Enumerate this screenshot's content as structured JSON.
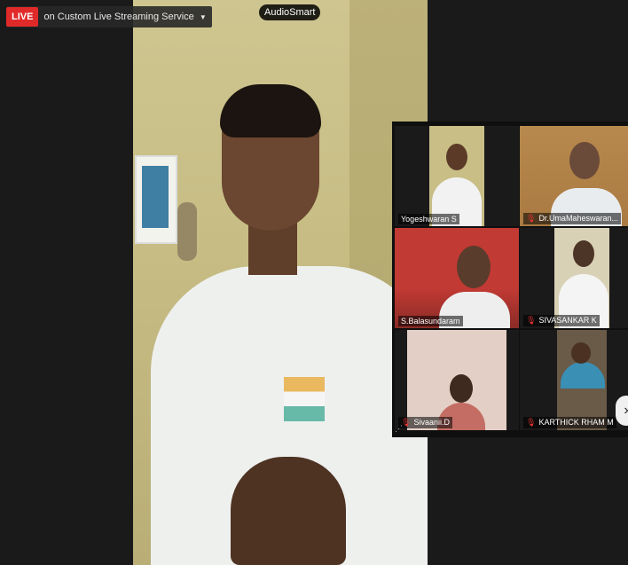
{
  "live": {
    "badge": "LIVE",
    "text": "on Custom Live Streaming Service"
  },
  "speaker_pill": "AudioSmart",
  "participants": [
    {
      "name": "Yogeshwaran S",
      "muted": false,
      "active": true
    },
    {
      "name": "Dr.UmaMaheswaran...",
      "muted": true,
      "active": false
    },
    {
      "name": "S.Balasundaram",
      "muted": false,
      "active": false
    },
    {
      "name": "SIVASANKAR K",
      "muted": true,
      "active": false
    },
    {
      "name": "Sivaanii.D",
      "muted": true,
      "active": false
    },
    {
      "name": "KARTHICK RHAM M",
      "muted": true,
      "active": false
    }
  ]
}
